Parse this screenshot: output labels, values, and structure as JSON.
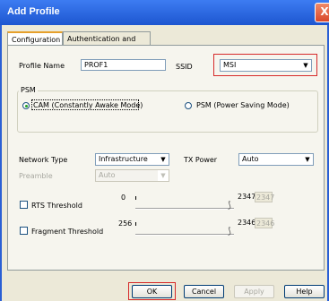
{
  "window": {
    "title": "Add Profile",
    "close_glyph": "X"
  },
  "tabs": [
    "Configuration",
    "Authentication and Security"
  ],
  "profile": {
    "name_label": "Profile Name",
    "name_value": "PROF1",
    "ssid_label": "SSID",
    "ssid_value": "MSI"
  },
  "psm": {
    "group_label": "PSM",
    "options": [
      "CAM (Constantly Awake Mode)",
      "PSM (Power Saving Mode)"
    ],
    "selected": "CAM (Constantly Awake Mode)"
  },
  "network": {
    "type_label": "Network Type",
    "type_value": "Infrastructure",
    "tx_label": "TX Power",
    "tx_value": "Auto",
    "preamble_label": "Preamble",
    "preamble_value": "Auto"
  },
  "thresholds": [
    {
      "label": "RTS Threshold",
      "min": "0",
      "max": "2347",
      "value": "2347",
      "checked": false
    },
    {
      "label": "Fragment Threshold",
      "min": "256",
      "max": "2346",
      "value": "2346",
      "checked": false
    }
  ],
  "buttons": {
    "ok": "OK",
    "cancel": "Cancel",
    "apply": "Apply",
    "help": "Help"
  },
  "colors": {
    "titlebar": "#2a5fd4",
    "highlight": "#d62a2a",
    "face": "#ece9d8"
  },
  "icons": {
    "dropdown": "▼",
    "slider_thumb": "⟆"
  }
}
